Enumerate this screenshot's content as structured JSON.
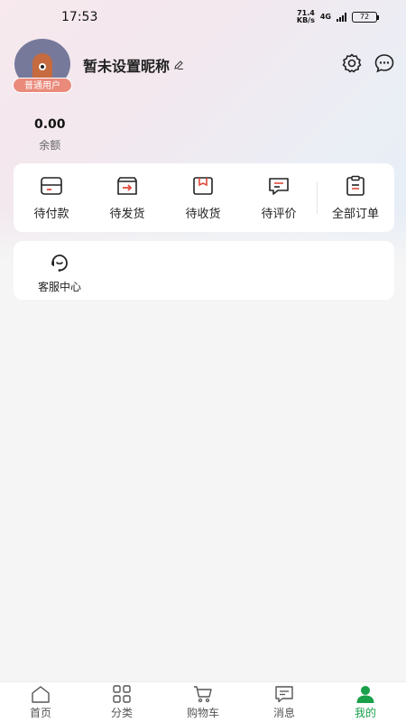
{
  "status_bar": {
    "time": "17:53",
    "net_speed_value": "71.4",
    "net_speed_unit": "KB/s",
    "network_type": "4G",
    "battery": "72"
  },
  "profile": {
    "nickname": "暂未设置昵称",
    "user_level": "普通用户"
  },
  "balance": {
    "amount": "0.00",
    "label": "余额"
  },
  "orders": [
    {
      "label": "待付款",
      "icon": "wallet-icon"
    },
    {
      "label": "待发货",
      "icon": "box-arrow-icon"
    },
    {
      "label": "待收货",
      "icon": "package-icon"
    },
    {
      "label": "待评价",
      "icon": "comment-icon"
    },
    {
      "label": "全部订单",
      "icon": "clipboard-icon"
    }
  ],
  "services": [
    {
      "label": "客服中心",
      "icon": "headset-icon"
    }
  ],
  "tabbar": [
    {
      "label": "首页",
      "icon": "home-icon",
      "active": false
    },
    {
      "label": "分类",
      "icon": "grid-icon",
      "active": false
    },
    {
      "label": "购物车",
      "icon": "cart-icon",
      "active": false
    },
    {
      "label": "消息",
      "icon": "message-icon",
      "active": false
    },
    {
      "label": "我的",
      "icon": "user-icon",
      "active": true
    }
  ],
  "colors": {
    "accent": "#1aa04a",
    "badge": "#e98a7b",
    "order_icon_accent": "#e24a3b"
  }
}
